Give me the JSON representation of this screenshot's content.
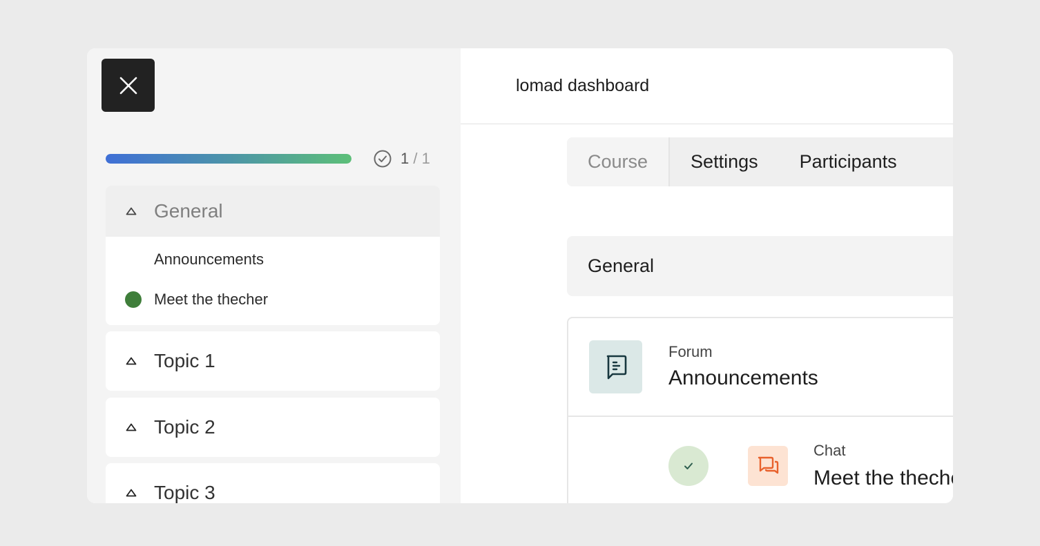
{
  "sidebar": {
    "close_icon": "close-icon",
    "progress": {
      "completed": "1",
      "separator": "/",
      "total": "1",
      "fraction": 1.0
    },
    "sections": [
      {
        "title": "General",
        "expanded": true,
        "activities": [
          {
            "label": "Announcements",
            "completed": false
          },
          {
            "label": "Meet the thecher",
            "completed": true
          }
        ]
      },
      {
        "title": "Topic 1",
        "expanded": false
      },
      {
        "title": "Topic 2",
        "expanded": false
      },
      {
        "title": "Topic 3",
        "expanded": false
      }
    ]
  },
  "main": {
    "title": "lomad dashboard",
    "tabs": [
      {
        "label": "Course",
        "active": true
      },
      {
        "label": "Settings",
        "active": false
      },
      {
        "label": "Participants",
        "active": false
      }
    ],
    "section_title": "General",
    "activities": [
      {
        "type": "Forum",
        "name": "Announcements",
        "icon": "forum-icon"
      },
      {
        "type": "Chat",
        "name": "Meet the thecher",
        "icon": "chat-icon",
        "completed": true
      }
    ]
  },
  "colors": {
    "progress_start": "#3f6fd6",
    "progress_end": "#5cbf78",
    "completed_dot": "#3f7e3a",
    "forum_tile": "#dbe8e7",
    "chat_tile": "#fde3d3",
    "chat_accent": "#e8612c"
  }
}
